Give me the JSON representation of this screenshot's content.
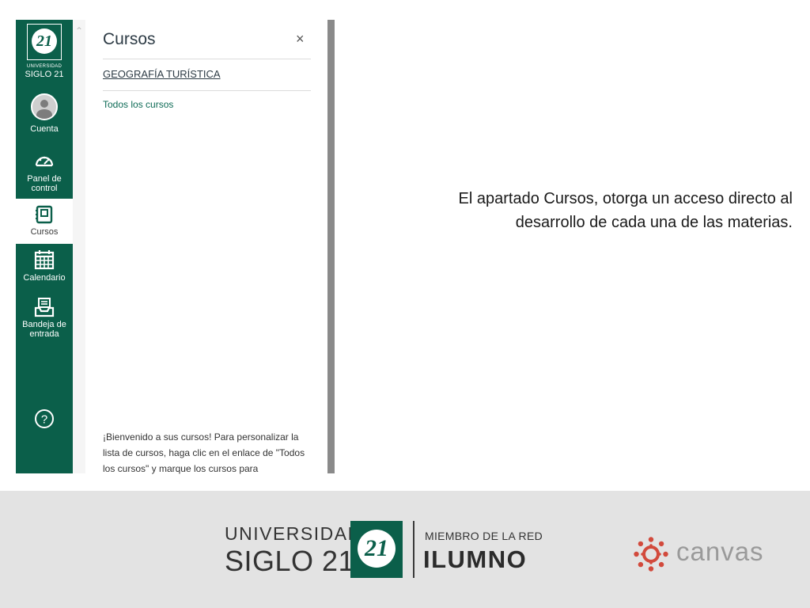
{
  "colors": {
    "rail_bg": "#0b5f4a",
    "tray_link": "#0e6b56",
    "footer_bg": "#e3e3e3",
    "canvas_red": "#d24a3c"
  },
  "rail": {
    "logo": {
      "line1": "UNIVERSIDAD",
      "line2": "SIGLO 21",
      "seal": "21"
    },
    "items": [
      {
        "label": "Cuenta",
        "icon": "user-avatar-icon"
      },
      {
        "label": "Panel de control",
        "icon": "dashboard-gauge-icon"
      },
      {
        "label": "Cursos",
        "icon": "courses-book-icon",
        "active": true
      },
      {
        "label": "Calendario",
        "icon": "calendar-icon"
      },
      {
        "label": "Bandeja de entrada",
        "icon": "inbox-icon"
      },
      {
        "label": "",
        "icon": "help-question-icon"
      }
    ]
  },
  "tray": {
    "title": "Cursos",
    "close": "×",
    "course": "GEOGRAFÍA TURÍSTICA",
    "all_courses": "Todos los cursos",
    "welcome": "¡Bienvenido a sus cursos! Para personalizar la lista de cursos, haga clic en el enlace de \"Todos los cursos\" y marque los cursos para"
  },
  "caption": {
    "line1": "El apartado Cursos, otorga un acceso directo al",
    "line2": "desarrollo de cada una de las materias."
  },
  "footer": {
    "universidad": "UNIVERSIDAD",
    "siglo": "SIGLO 21",
    "seal": "21",
    "miembro": "MIEMBRO DE LA RED",
    "ilumno": "ILUMNO",
    "canvas": "canvas"
  }
}
